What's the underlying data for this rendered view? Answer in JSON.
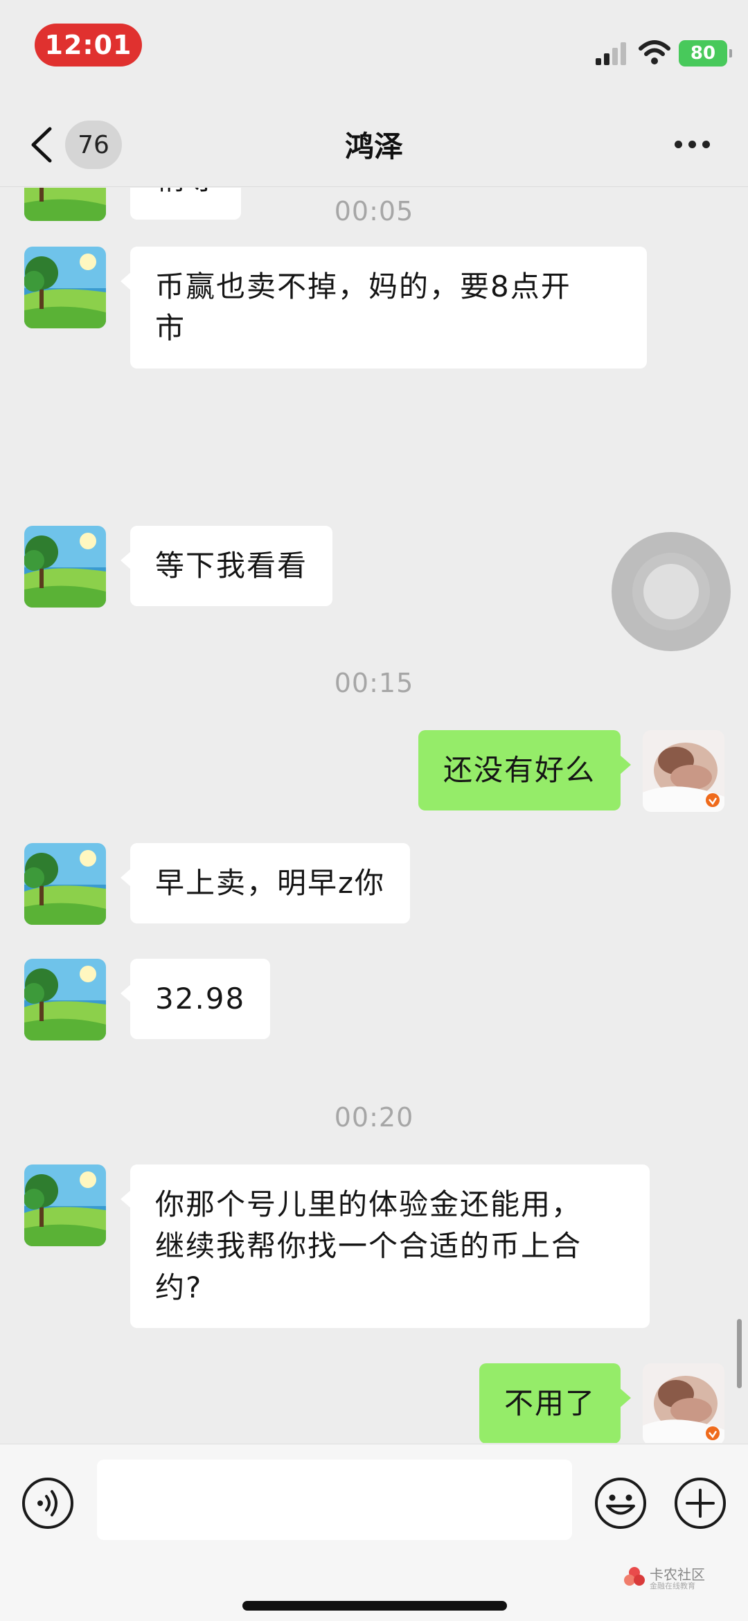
{
  "status_bar": {
    "time": "12:01",
    "battery": "80"
  },
  "nav": {
    "unread_count": "76",
    "title": "鸿泽"
  },
  "messages": [
    {
      "type": "incoming",
      "text": "稍等"
    },
    {
      "type": "timestamp",
      "text": "00:05"
    },
    {
      "type": "incoming",
      "text": "币赢也卖不掉，妈的，要8点开\n市"
    },
    {
      "type": "incoming",
      "text": "等下我看看"
    },
    {
      "type": "timestamp",
      "text": "00:15"
    },
    {
      "type": "outgoing",
      "text": "还没有好么"
    },
    {
      "type": "incoming",
      "text": "早上卖，明早z你"
    },
    {
      "type": "incoming",
      "text": "32.98"
    },
    {
      "type": "timestamp",
      "text": "00:20"
    },
    {
      "type": "incoming",
      "text": "你那个号儿里的体验金还能用，\n继续我帮你找一个合适的币上合\n约?"
    },
    {
      "type": "outgoing",
      "text": "不用了"
    }
  ],
  "input": {
    "value": "",
    "placeholder": ""
  },
  "watermark": {
    "text": "卡农社区",
    "sub": "金融在线教育"
  },
  "colors": {
    "background": "#ededed",
    "outgoing_bubble": "#95ec69",
    "incoming_bubble": "#ffffff",
    "time_pill": "#e0312f",
    "battery": "#48c95b"
  },
  "icons": [
    "back-icon",
    "more-icon",
    "signal-icon",
    "wifi-icon",
    "voice-icon",
    "emoji-icon",
    "plus-icon"
  ]
}
